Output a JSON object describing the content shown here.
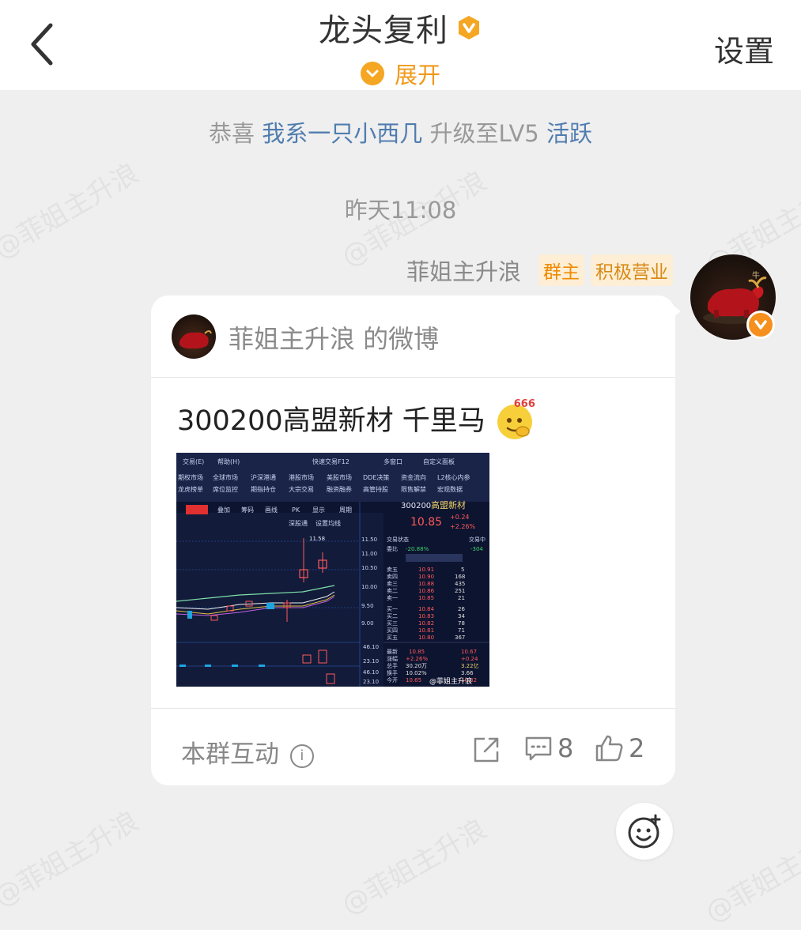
{
  "header": {
    "title": "龙头复利",
    "expand_label": "展开",
    "settings_label": "设置"
  },
  "system_message": {
    "prefix": "恭喜",
    "user": "我系一只小西几",
    "middle": "升级至LV5",
    "level_tag": "活跃"
  },
  "timestamp": "昨天11:08",
  "message": {
    "sender": "菲姐主升浪",
    "tags": [
      "群主",
      "积极营业"
    ],
    "card": {
      "source": "菲姐主升浪 的微博",
      "text": "300200高盟新材 千里马",
      "emoji_caption": "666",
      "footer_label": "本群互动",
      "comment_count": "8",
      "like_count": "2"
    },
    "screenshot": {
      "stock_code": "300200",
      "stock_name": "高盟新材",
      "price": "10.85",
      "change": "+0.24",
      "change_pct": "+2.26%",
      "high_label": "11.58",
      "watermark": "@菲姐主升浪"
    }
  },
  "watermark_text": "@菲姐主升浪",
  "colors": {
    "accent_orange": "#f5a623",
    "link_blue": "#507daf",
    "chart_bg": "#0f1935"
  }
}
